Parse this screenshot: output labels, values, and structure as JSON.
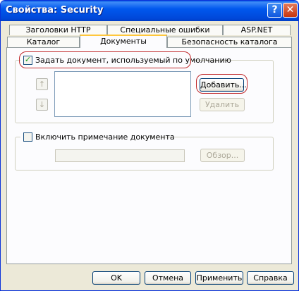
{
  "window": {
    "title": "Свойства: Security"
  },
  "tabs": {
    "row1": [
      "Заголовки HTTP",
      "Специальные ошибки",
      "ASP.NET"
    ],
    "row2": [
      "Каталог",
      "Документы",
      "Безопасность каталога"
    ],
    "active": "Документы"
  },
  "default_doc": {
    "checkbox_label": "Задать документ, используемый по умолчанию",
    "checked": true,
    "documents": [],
    "add_button": "Добавить...",
    "remove_button": "Удалить",
    "move_up_icon": "arrow-up-icon",
    "move_down_icon": "arrow-down-icon"
  },
  "footer_doc": {
    "checkbox_label": "Включить примечание документа",
    "checked": false,
    "path_value": "",
    "browse_button": "Обзор..."
  },
  "buttons": {
    "ok": "OK",
    "cancel": "Отмена",
    "apply": "Применить",
    "help": "Справка"
  },
  "colors": {
    "titlebar": "#0058ee",
    "highlight_ring": "#c0292b",
    "active_tab_accent": "#ffc73c"
  }
}
